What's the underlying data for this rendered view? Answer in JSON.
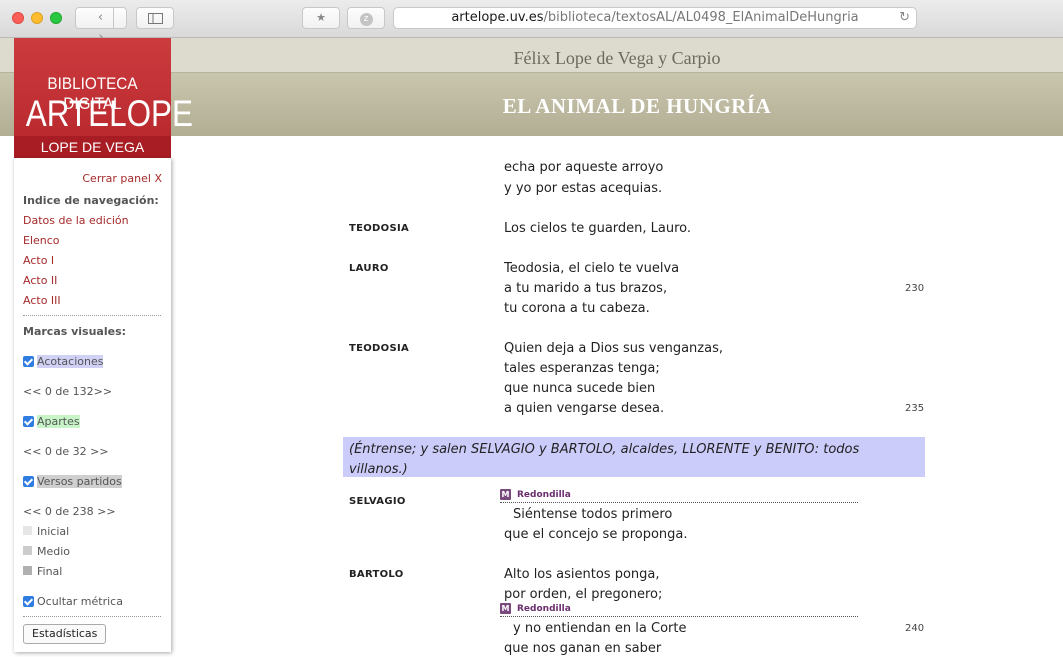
{
  "browser": {
    "url_host": "artelope.uv.es",
    "url_path": "/biblioteca/textosAL/AL0498_ElAnimalDeHungria"
  },
  "header": {
    "author": "Félix Lope de Vega y Carpio",
    "title": "EL ANIMAL DE HUNGRÍA"
  },
  "logo": {
    "line1": "BIBLIOTECA DIGITAL",
    "line2": "ARTELOPE",
    "line3": "LOPE DE VEGA"
  },
  "panel": {
    "close_label": "Cerrar panel X",
    "nav_heading": "Indice de navegación:",
    "nav_links": [
      "Datos de la edición",
      "Elenco",
      "Acto I",
      "Acto II",
      "Acto III"
    ],
    "marks_heading": "Marcas visuales:",
    "acotaciones": "Acotaciones",
    "acotaciones_nav": "<< 0 de 132>>",
    "apartes": "Apartes",
    "apartes_nav": "<< 0 de 32 >>",
    "versos_partidos": "Versos partidos",
    "versos_nav": "<< 0 de 238 >>",
    "legend": [
      "Inicial",
      "Medio",
      "Final"
    ],
    "legend_colors": [
      "#e6e6e6",
      "#cccccc",
      "#b0b0b0"
    ],
    "ocultar_metrica": "Ocultar métrica",
    "stats_button": "Estadísticas"
  },
  "text": {
    "cut_line": "echa por aqueste arroyo",
    "line_top": "y yo por estas acequias.",
    "teodosia1_speaker": "TEODOSIA",
    "teodosia1_lines": [
      "Los cielos te guarden, Lauro."
    ],
    "lauro_speaker": "LAURO",
    "lauro_lines": [
      "Teodosia, el cielo te vuelva",
      "a tu marido a tus brazos,",
      "tu corona a tu cabeza."
    ],
    "num_230": "230",
    "teodosia2_speaker": "TEODOSIA",
    "teodosia2_lines": [
      "Quien deja a Dios sus venganzas,",
      "tales esperanzas tenga;",
      "que nunca sucede bien",
      "a quien vengarse desea."
    ],
    "num_235": "235",
    "stage_direction": "(Éntrense; y salen SELVAGIO y BARTOLO, alcaldes, LLORENTE y BENITO: todos villanos.)",
    "meter_badge": "M",
    "meter_label": "Redondilla",
    "selvagio_speaker": "SELVAGIO",
    "selvagio_lines": [
      "Siéntense todos primero",
      "que el concejo se proponga."
    ],
    "bartolo_speaker": "BARTOLO",
    "bartolo_lines": [
      "Alto los asientos ponga,",
      "por orden, el pregonero;",
      "y no entiendan en la Corte",
      "que nos ganan en saber"
    ],
    "num_240": "240"
  }
}
